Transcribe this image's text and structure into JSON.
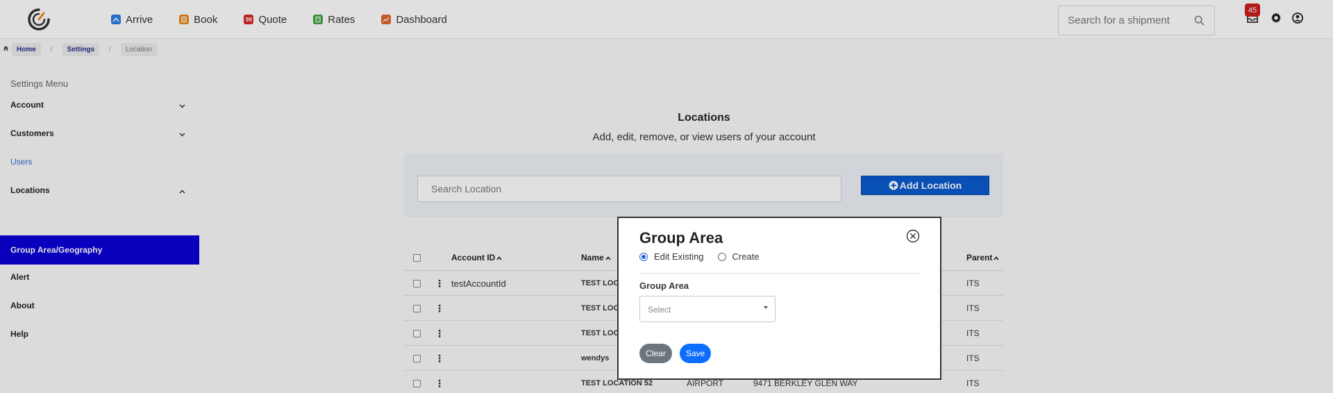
{
  "nav": {
    "items": [
      {
        "label": "Arrive",
        "icon": "arrive-icon",
        "color": "#2d7be0"
      },
      {
        "label": "Book",
        "icon": "book-icon",
        "color": "#e88a1a"
      },
      {
        "label": "Quote",
        "icon": "quote-icon",
        "color": "#d62626",
        "glyph": "99"
      },
      {
        "label": "Rates",
        "icon": "rates-icon",
        "color": "#3fa33f"
      },
      {
        "label": "Dashboard",
        "icon": "dashboard-icon",
        "color": "#e0662d"
      }
    ],
    "search_placeholder": "Search for a shipment",
    "notification_count": "45"
  },
  "breadcrumb": {
    "items": [
      "Home",
      "Settings",
      "Location"
    ]
  },
  "sidebar": {
    "title": "Settings Menu",
    "items": [
      {
        "label": "Account"
      },
      {
        "label": "Customers"
      },
      {
        "label": "Users"
      },
      {
        "label": "Locations"
      },
      {
        "label": "Group Area/Geography"
      },
      {
        "label": "Alert"
      },
      {
        "label": "About"
      },
      {
        "label": "Help"
      }
    ]
  },
  "main": {
    "title": "Locations",
    "subtitle": "Add, edit, remove, or view users of your account",
    "search_placeholder": "Search Location",
    "add_button": "Add Location"
  },
  "table": {
    "headers": {
      "account_id": "Account ID",
      "name": "Name",
      "parent": "Parent"
    },
    "rows": [
      {
        "account_id": "testAccountId",
        "name": "TEST LOC",
        "type": "",
        "address": "",
        "parent": "ITS"
      },
      {
        "account_id": "",
        "name": "TEST LOC",
        "type": "",
        "address": "",
        "parent": "ITS"
      },
      {
        "account_id": "",
        "name": "TEST LOC",
        "type": "",
        "address": "",
        "parent": "ITS"
      },
      {
        "account_id": "",
        "name": "wendys",
        "type": "",
        "address": "",
        "parent": "ITS"
      },
      {
        "account_id": "",
        "name": "TEST LOCATION 52",
        "type": "AIRPORT",
        "address": "9471 BERKLEY GLEN WAY",
        "parent": "ITS"
      }
    ]
  },
  "modal": {
    "title": "Group Area",
    "radio_edit": "Edit Existing",
    "radio_create": "Create",
    "field_label": "Group Area",
    "select_value": "Select",
    "clear_button": "Clear",
    "save_button": "Save"
  }
}
